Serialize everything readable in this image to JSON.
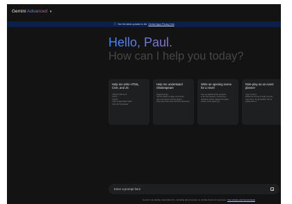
{
  "app": {
    "name": "Gemini",
    "tier": "Advanced"
  },
  "banner": {
    "text": "See the latest updates to the",
    "link": "Gemini Apps Privacy Hub"
  },
  "greeting": {
    "hello": "Hello, Paul.",
    "subtitle": "How can I help you today?"
  },
  "cards": [
    {
      "title": "Help me write HTML, CSS, and JS",
      "preview": "<!DOCTYPE html>\n<html>\n<head>\n<title>Image Slider</title>\n<link rel=\"stylesheet\""
    },
    {
      "title": "Help me understand Shakespeare",
      "preview": "Original Quote:\n\"All the world's a stage, And all the\nmen and women merely players;\nThey have their exits and their entrances\""
    },
    {
      "title": "Write an opening scene for a novel",
      "preview": "The rain lashed at the windows\nof the old mansion, drumming a\nrelentless rhythm against the glass.\nInside, a lone figure sat"
    },
    {
      "title": "Role-play as an event planner",
      "preview": "Type of event:\nWelcome! I'd love to help you plan\nyour event. To get started, tell me\na little about it"
    }
  ],
  "prompt": {
    "placeholder": "Enter a prompt here"
  },
  "disclaimer": {
    "text": "Gemini may display inaccurate info, including about people, so double-check its responses.",
    "link": "Your privacy and Gemini Apps"
  }
}
